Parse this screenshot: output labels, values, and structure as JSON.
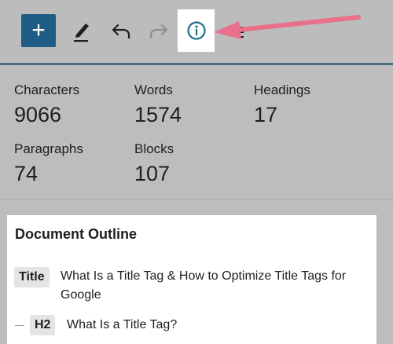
{
  "toolbar": {
    "buttons": [
      {
        "name": "add",
        "icon": "plus-icon"
      },
      {
        "name": "tools",
        "icon": "pencil-icon"
      },
      {
        "name": "undo",
        "icon": "undo-icon"
      },
      {
        "name": "redo",
        "icon": "redo-icon",
        "disabled": true
      },
      {
        "name": "details",
        "icon": "info-icon",
        "active": true
      },
      {
        "name": "list-view",
        "icon": "list-view-icon"
      }
    ],
    "add_symbol": "+",
    "accent_color": "#1f5c85",
    "info_color": "#1f6f8b",
    "arrow_color": "#e8708a"
  },
  "stats": [
    {
      "label": "Characters",
      "value": "9066"
    },
    {
      "label": "Words",
      "value": "1574"
    },
    {
      "label": "Headings",
      "value": "17"
    },
    {
      "label": "Paragraphs",
      "value": "74"
    },
    {
      "label": "Blocks",
      "value": "107"
    }
  ],
  "outline": {
    "title": "Document Outline",
    "items": [
      {
        "tag": "Title",
        "text": "What Is a Title Tag & How to Optimize Title Tags for Google"
      },
      {
        "tag": "H2",
        "text": "What Is a Title Tag?"
      }
    ]
  }
}
